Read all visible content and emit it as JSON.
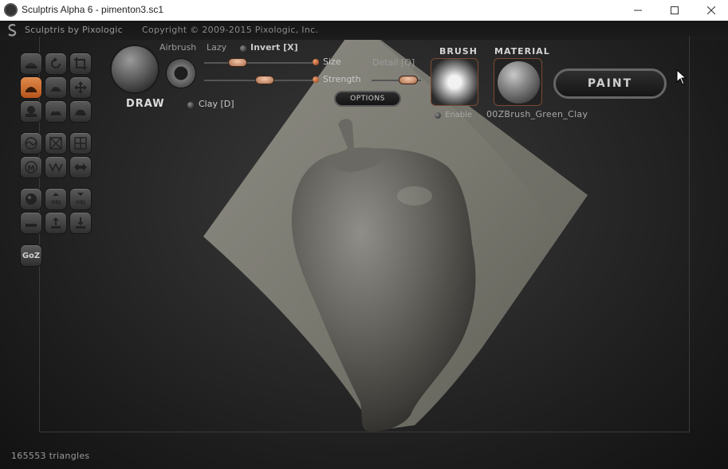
{
  "window": {
    "title": "Sculptris Alpha 6 - pimenton3.sc1",
    "controls": [
      "minimize-icon",
      "maximize-icon",
      "close-icon"
    ]
  },
  "header": {
    "app_name": "Sculptris by Pixologic",
    "copyright": "Copyright © 2009-2015 Pixologic, Inc."
  },
  "tools": {
    "rows": [
      [
        "flatten-icon",
        "rotate-icon",
        "crop-icon"
      ],
      [
        "draw-icon",
        "inflate-icon",
        "grab-icon"
      ],
      [
        "pinch-icon",
        "crease-icon",
        "smooth-icon"
      ],
      [
        "reduce-brush-icon",
        "reduce-selection-icon",
        "subdivide-icon"
      ],
      [
        "mask-icon",
        "symmetry-icon",
        "mirror-icon"
      ],
      [
        "new-sphere-icon",
        "import-obj-icon",
        "export-obj-icon"
      ],
      [
        "new-plane-icon",
        "open-icon",
        "save-icon"
      ],
      [
        "goz-icon"
      ]
    ],
    "active": "draw-icon",
    "goz_label": "GoZ"
  },
  "brush_settings": {
    "tool_name": "DRAW",
    "airbrush": "Airbrush",
    "lazy": "Lazy",
    "invert": "Invert [X]",
    "clay": "Clay [D]",
    "size": "Size",
    "strength": "Strength",
    "detail": "Detail [Q]",
    "options": "OPTIONS"
  },
  "brush": {
    "title": "BRUSH",
    "enable": "Enable"
  },
  "material": {
    "title": "MATERIAL",
    "name": "00ZBrush_Green_Clay"
  },
  "paint_button": "PAINT",
  "status": {
    "triangles": "165553 triangles"
  }
}
